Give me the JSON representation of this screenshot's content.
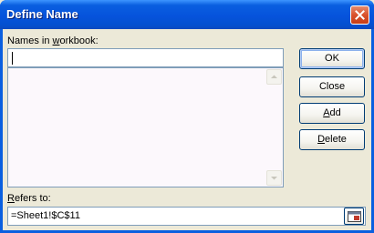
{
  "window": {
    "title": "Define Name"
  },
  "names": {
    "label_pre": "Names in ",
    "label_underline": "w",
    "label_post": "orkbook:",
    "input_value": "",
    "list_items": []
  },
  "refers": {
    "label_underline": "R",
    "label_post": "efers to:",
    "value": "=Sheet1!$C$11"
  },
  "buttons": {
    "ok": "OK",
    "close": "Close",
    "add_underline": "A",
    "add_post": "dd",
    "delete_underline": "D",
    "delete_post": "elete"
  },
  "colors": {
    "titlebar": "#0A5FE0",
    "close_button": "#D9512C",
    "dialog_face": "#ECE9D8",
    "field_border": "#7F9DB9"
  },
  "icons": {
    "close": "close-icon",
    "collapse": "collapse-dialog-icon",
    "scroll_up": "scroll-up-arrow-icon",
    "scroll_down": "scroll-down-arrow-icon"
  }
}
